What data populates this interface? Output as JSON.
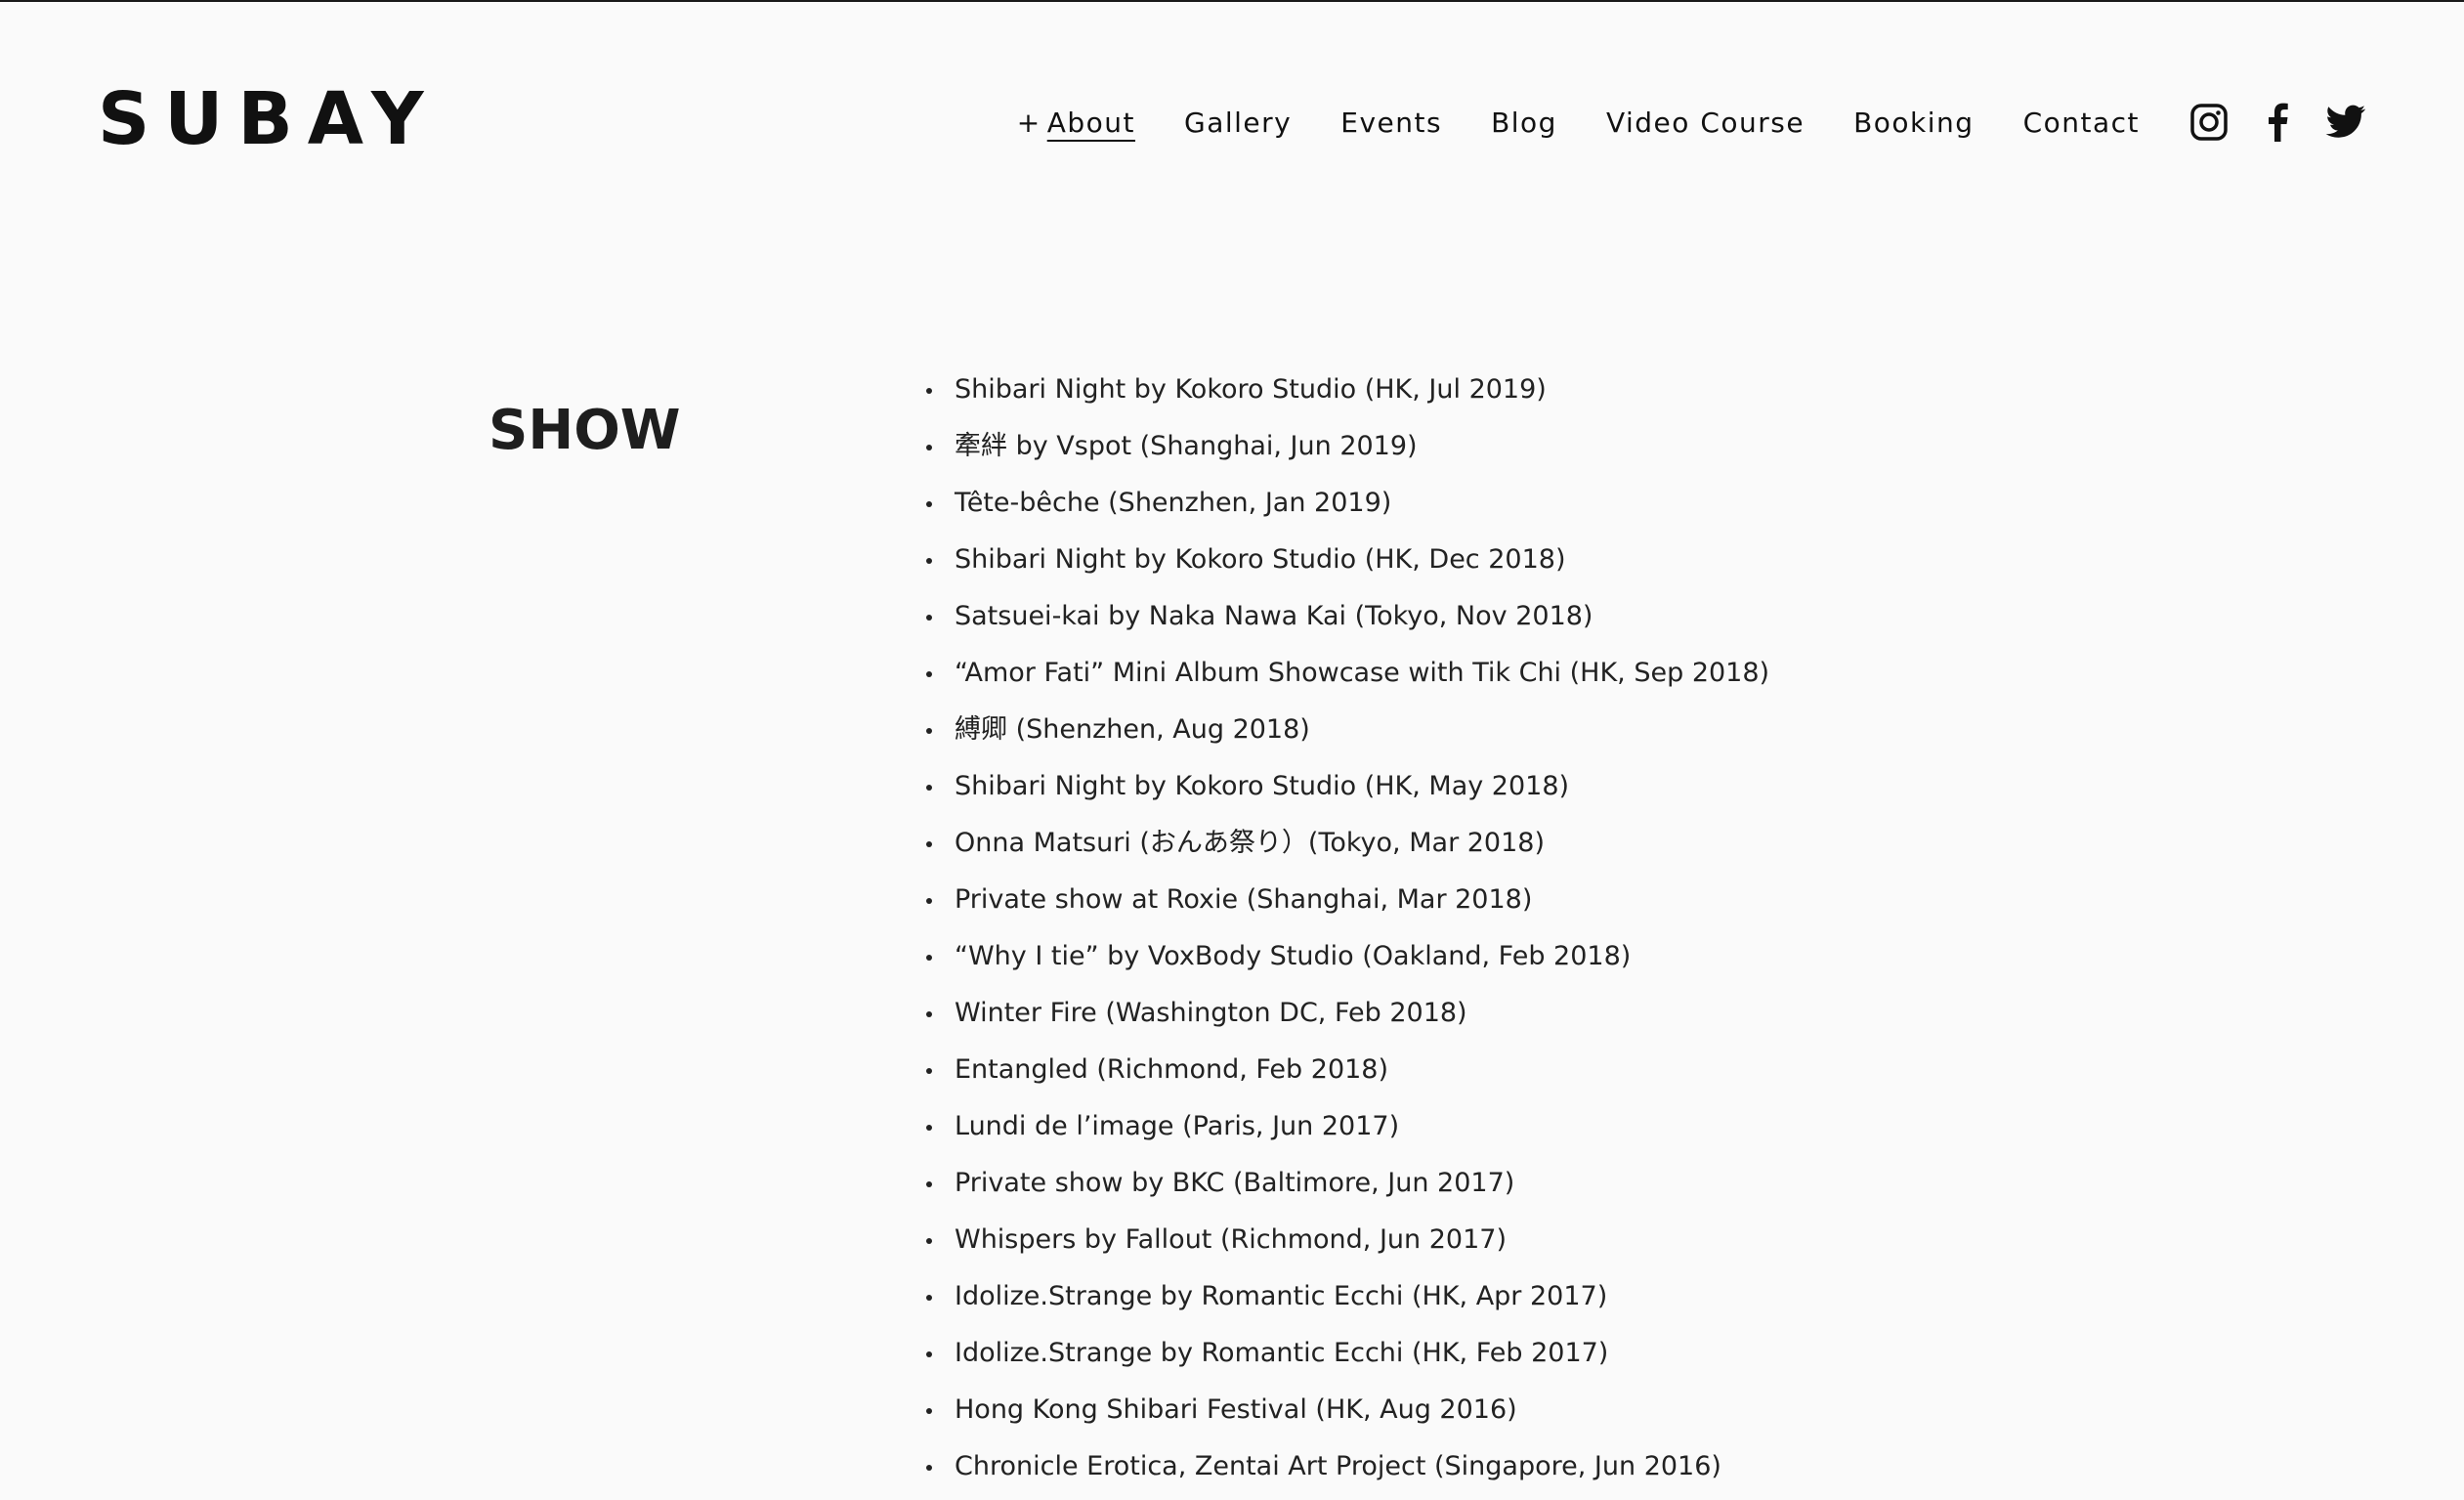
{
  "site": {
    "logo": "SUBAY"
  },
  "nav": {
    "items": [
      {
        "prefix": "+",
        "label": "About",
        "active": true
      },
      {
        "label": "Gallery"
      },
      {
        "label": "Events"
      },
      {
        "label": "Blog"
      },
      {
        "label": "Video Course"
      },
      {
        "label": "Booking"
      },
      {
        "label": "Contact"
      }
    ],
    "social": [
      "instagram-icon",
      "facebook-icon",
      "twitter-icon"
    ]
  },
  "main": {
    "section_title": "SHOW",
    "shows": [
      "Shibari Night by Kokoro Studio (HK, Jul 2019)",
      "牽絆 by Vspot (Shanghai, Jun 2019)",
      "Tête-bêche (Shenzhen, Jan 2019)",
      "Shibari Night by Kokoro Studio (HK, Dec 2018)",
      "Satsuei-kai by Naka Nawa Kai (Tokyo, Nov 2018)",
      "“Amor Fati” Mini Album Showcase with Tik Chi (HK, Sep 2018)",
      "縛卿 (Shenzhen, Aug 2018)",
      "Shibari Night by Kokoro Studio (HK, May 2018)",
      "Onna Matsuri (おんあ祭り）(Tokyo, Mar 2018)",
      "Private show at Roxie (Shanghai, Mar 2018)",
      "“Why I tie” by VoxBody Studio (Oakland, Feb 2018)",
      "Winter Fire (Washington DC, Feb 2018)",
      "Entangled (Richmond, Feb 2018)",
      "Lundi de l’image (Paris, Jun 2017)",
      "Private show by BKC (Baltimore, Jun 2017)",
      "Whispers by Fallout (Richmond, Jun 2017)",
      "Idolize.Strange by Romantic Ecchi (HK, Apr 2017)",
      "Idolize.Strange by Romantic Ecchi (HK, Feb 2017)",
      "Hong Kong Shibari Festival (HK, Aug 2016)",
      "Chronicle Erotica, Zentai Art Project (Singapore, Jun 2016)"
    ]
  }
}
